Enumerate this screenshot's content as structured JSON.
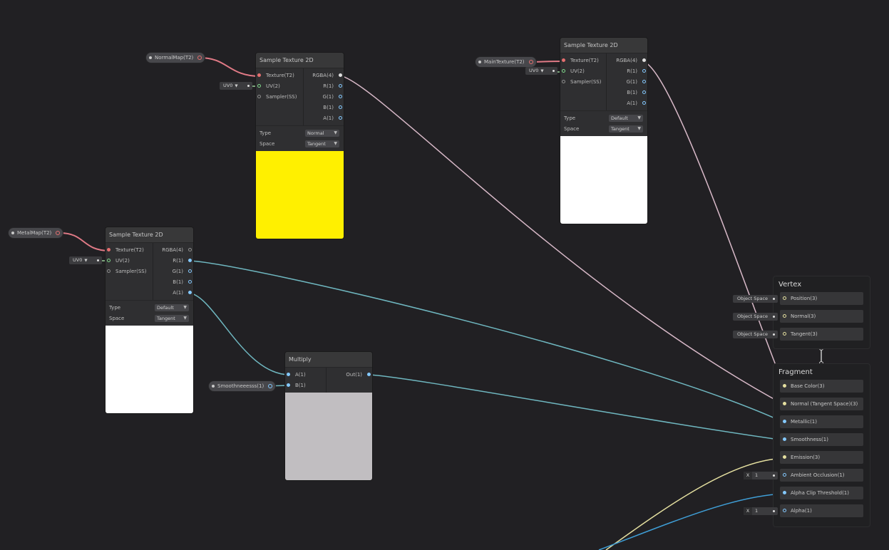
{
  "colors": {
    "background": "#212023",
    "wire_texture": "#e17a86",
    "wire_color": "#d8b9c8",
    "wire_float": "#6fb7c0",
    "wire_vector3": "#e5e0a0",
    "wire_vector2": "#9ad19a",
    "wire_blue": "#3f9ed6",
    "preview_yellow": "#fff000",
    "preview_white": "#ffffff",
    "preview_gray": "#c1bec1"
  },
  "properties": {
    "normal_map": "NormalMap(T2)",
    "main_texture": "MainTexture(T2)",
    "metal_map": "MetalMap(T2)",
    "smoothness": "Smoothneeesss(1)"
  },
  "uv_default": "UV0",
  "sample_nodes": [
    {
      "title": "Sample Texture 2D",
      "inputs": [
        "Texture(T2)",
        "UV(2)",
        "Sampler(SS)"
      ],
      "outputs": [
        "RGBA(4)",
        "R(1)",
        "G(1)",
        "B(1)",
        "A(1)"
      ],
      "type_label": "Type",
      "type_value": "Normal",
      "space_label": "Space",
      "space_value": "Tangent"
    },
    {
      "title": "Sample Texture 2D",
      "inputs": [
        "Texture(T2)",
        "UV(2)",
        "Sampler(SS)"
      ],
      "outputs": [
        "RGBA(4)",
        "R(1)",
        "G(1)",
        "B(1)",
        "A(1)"
      ],
      "type_label": "Type",
      "type_value": "Default",
      "space_label": "Space",
      "space_value": "Tangent"
    },
    {
      "title": "Sample Texture 2D",
      "inputs": [
        "Texture(T2)",
        "UV(2)",
        "Sampler(SS)"
      ],
      "outputs": [
        "RGBA(4)",
        "R(1)",
        "G(1)",
        "B(1)",
        "A(1)"
      ],
      "type_label": "Type",
      "type_value": "Default",
      "space_label": "Space",
      "space_value": "Tangent"
    }
  ],
  "multiply": {
    "title": "Multiply",
    "inputs": [
      "A(1)",
      "B(1)"
    ],
    "output": "Out(1)"
  },
  "vertex": {
    "title": "Vertex",
    "space_value": "Object Space",
    "blocks": [
      "Position(3)",
      "Normal(3)",
      "Tangent(3)"
    ]
  },
  "fragment": {
    "title": "Fragment",
    "blocks": [
      "Base Color(3)",
      "Normal (Tangent Space)(3)",
      "Metallic(1)",
      "Smoothness(1)",
      "Emission(3)",
      "Ambient Occlusion(1)",
      "Alpha Clip Threshold(1)",
      "Alpha(1)"
    ],
    "x_label": "X",
    "ao_value": "1",
    "alpha_value": "1"
  }
}
